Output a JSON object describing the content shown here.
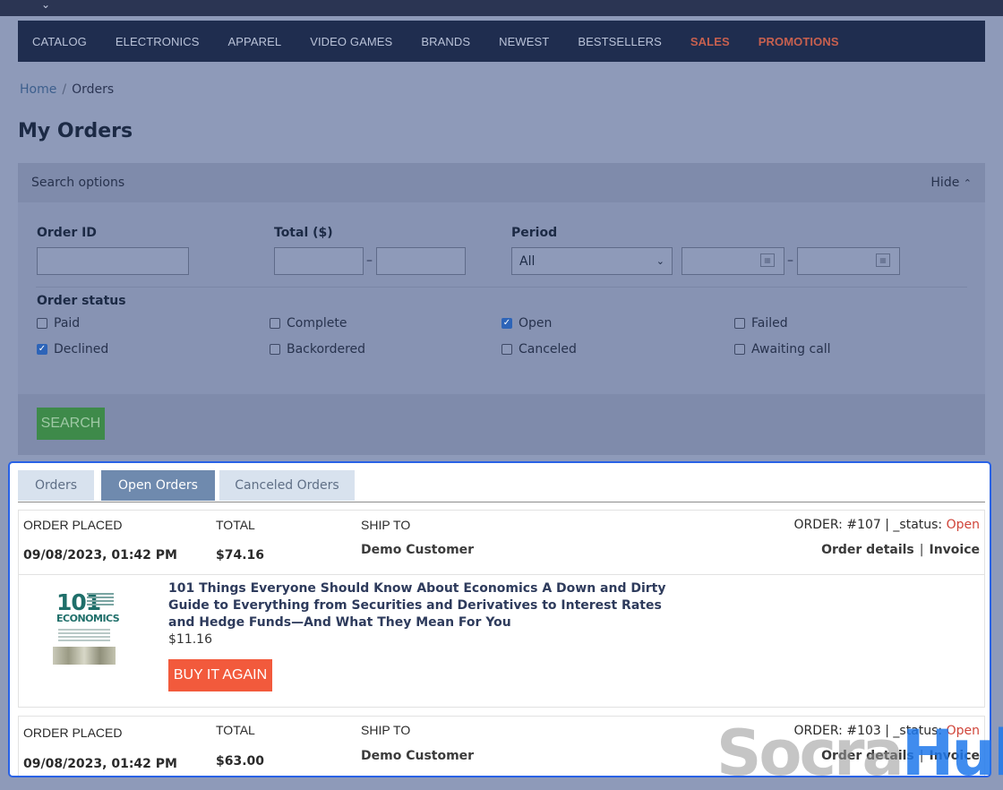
{
  "nav": {
    "items": [
      "CATALOG",
      "ELECTRONICS",
      "APPAREL",
      "VIDEO GAMES",
      "BRANDS",
      "NEWEST",
      "BESTSELLERS"
    ],
    "accent_items": [
      "SALES",
      "PROMOTIONS"
    ],
    "accent_color": "#c7604f"
  },
  "breadcrumb": {
    "home": "Home",
    "separator": "/",
    "current": "Orders"
  },
  "page_title": "My Orders",
  "search": {
    "header": "Search options",
    "hide_label": "Hide",
    "order_id_label": "Order ID",
    "total_label": "Total ($)",
    "period_label": "Period",
    "period_value": "All",
    "range_dash": "–",
    "status_label": "Order status",
    "statuses": [
      {
        "label": "Paid",
        "checked": false
      },
      {
        "label": "Complete",
        "checked": false
      },
      {
        "label": "Open",
        "checked": true
      },
      {
        "label": "Failed",
        "checked": false
      },
      {
        "label": "Declined",
        "checked": true
      },
      {
        "label": "Backordered",
        "checked": false
      },
      {
        "label": "Canceled",
        "checked": false
      },
      {
        "label": "Awaiting call",
        "checked": false
      }
    ],
    "button": "SEARCH",
    "button_color": "#3e8a4a"
  },
  "tabs": [
    {
      "label": "Orders",
      "active": false
    },
    {
      "label": "Open Orders",
      "active": true
    },
    {
      "label": "Canceled Orders",
      "active": false
    }
  ],
  "orders": [
    {
      "placed_label": "ORDER PLACED",
      "placed_value": "09/08/2023, 01:42 PM",
      "total_label": "TOTAL",
      "total_value": "$74.16",
      "ship_label": "SHIP TO",
      "ship_value": "Demo Customer",
      "order_prefix": "ORDER: #107 | _status: ",
      "status": "Open",
      "details_label": "Order details",
      "invoice_label": "Invoice",
      "item": {
        "title": "101 Things Everyone Should Know About Economics A Down and Dirty Guide to Everything from Securities and Derivatives to Interest Rates and Hedge Funds—And What They Mean For You",
        "price": "$11.16",
        "cover_big": "101",
        "cover_word": "ECONOMICS",
        "buy_label": "BUY IT AGAIN"
      }
    },
    {
      "placed_label": "ORDER PLACED",
      "placed_value": "09/08/2023, 01:42 PM",
      "total_label": "TOTAL",
      "total_value": "$63.00",
      "ship_label": "SHIP TO",
      "ship_value": "Demo Customer",
      "order_prefix": "ORDER: #103 | _status: ",
      "status": "Open",
      "details_label": "Order details",
      "invoice_label": "Invoice"
    }
  ],
  "status_color": "#d0453a",
  "buy_color": "#f25a3c",
  "watermark": {
    "part1": "Socra",
    "part2": "Hub"
  }
}
